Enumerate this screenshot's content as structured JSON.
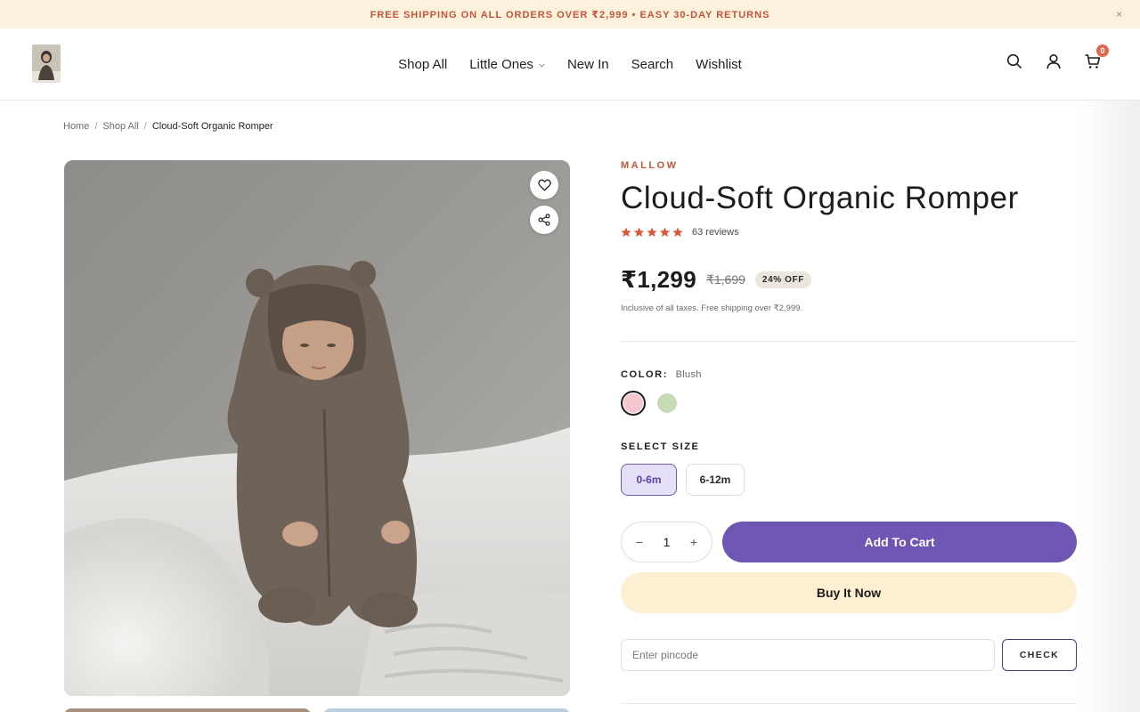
{
  "announcement": {
    "text": "FREE SHIPPING ON ALL ORDERS OVER ₹2,999 • EASY 30-DAY RETURNS",
    "close": "×"
  },
  "header": {
    "nav": [
      {
        "label": "Shop All",
        "has_dropdown": false
      },
      {
        "label": "Little Ones",
        "has_dropdown": true
      },
      {
        "label": "New In",
        "has_dropdown": false
      },
      {
        "label": "Search",
        "has_dropdown": false
      },
      {
        "label": "Wishlist",
        "has_dropdown": false
      }
    ],
    "icons": [
      "search-icon",
      "account-icon",
      "cart-icon"
    ],
    "cart_count": "0"
  },
  "breadcrumb": {
    "home": "Home",
    "shop_all": "Shop All",
    "current": "Cloud-Soft Organic Romper",
    "separator": "/"
  },
  "gallery": {
    "actions": [
      "heart-icon",
      "share-icon"
    ]
  },
  "product": {
    "brand": "MALLOW",
    "title": "Cloud-Soft Organic Romper",
    "rating": 5,
    "reviews": "63 reviews",
    "price": "₹1,299",
    "compare_price": "₹1,699",
    "discount": "24% OFF",
    "tax_note": "Inclusive of all taxes. Free shipping over ₹2,999.",
    "color_label": "COLOR:",
    "color_value": "Blush",
    "colors": [
      {
        "name": "Blush",
        "hex": "#f6c7cf",
        "selected": true
      },
      {
        "name": "Sage",
        "hex": "#c7dbb6",
        "selected": false
      }
    ],
    "size_label": "SELECT SIZE",
    "sizes": [
      {
        "label": "0-6m",
        "selected": true
      },
      {
        "label": "6-12m",
        "selected": false
      }
    ],
    "quantity": "1",
    "qty_minus": "−",
    "qty_plus": "+",
    "add_to_cart": "Add To Cart",
    "buy_now": "Buy It Now",
    "pincode_placeholder": "Enter pincode",
    "check": "CHECK"
  },
  "colors": {
    "accent": "#6e56b3",
    "brand_text": "#c4553a",
    "announce_bg": "#fcf1dc",
    "buy_now_bg": "#fdf0d2"
  }
}
